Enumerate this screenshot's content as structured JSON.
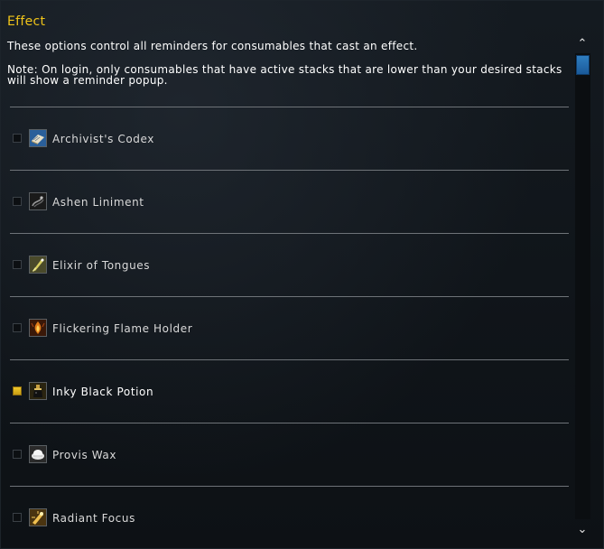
{
  "section": {
    "title": "Effect",
    "description": "These options control all reminders for consumables that cast an effect.",
    "note": "Note: On login, only consumables that have active stacks that are lower than your desired stacks will show a reminder popup."
  },
  "items": [
    {
      "label": "Archivist's Codex",
      "checked": false,
      "icon": "book-icon"
    },
    {
      "label": "Ashen Liniment",
      "checked": false,
      "icon": "liniment-icon"
    },
    {
      "label": "Elixir of Tongues",
      "checked": false,
      "icon": "elixir-icon"
    },
    {
      "label": "Flickering Flame Holder",
      "checked": false,
      "icon": "flame-icon"
    },
    {
      "label": "Inky Black Potion",
      "checked": true,
      "icon": "potion-icon"
    },
    {
      "label": "Provis Wax",
      "checked": false,
      "icon": "wax-icon"
    },
    {
      "label": "Radiant Focus",
      "checked": false,
      "icon": "focus-icon"
    }
  ],
  "scrollbar": {
    "up_glyph": "⌃",
    "down_glyph": "⌄",
    "position": 0
  },
  "colors": {
    "title": "#f0c419",
    "checkbox_checked": "#e0b41e",
    "scroll_thumb": "#2f7ec0"
  }
}
